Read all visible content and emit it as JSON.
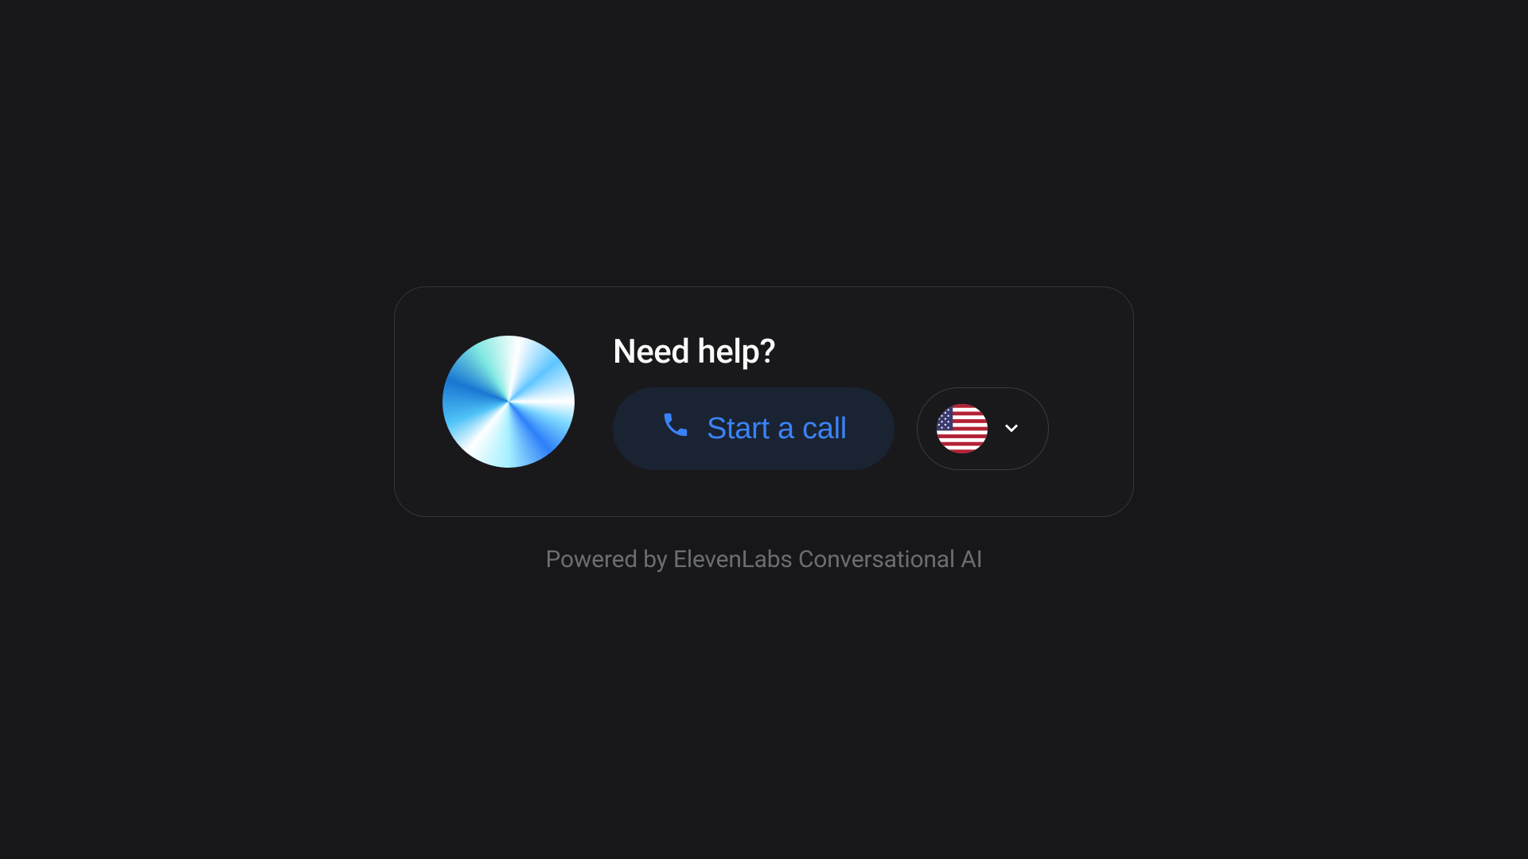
{
  "widget": {
    "heading": "Need help?",
    "call_button_label": "Start a call",
    "selected_language": "en-US",
    "selected_language_flag": "us"
  },
  "footer": {
    "powered_by": "Powered by ElevenLabs Conversational AI"
  },
  "colors": {
    "background": "#171719",
    "accent": "#3b82f6",
    "text": "#fafafa",
    "muted": "#6b6d72"
  }
}
